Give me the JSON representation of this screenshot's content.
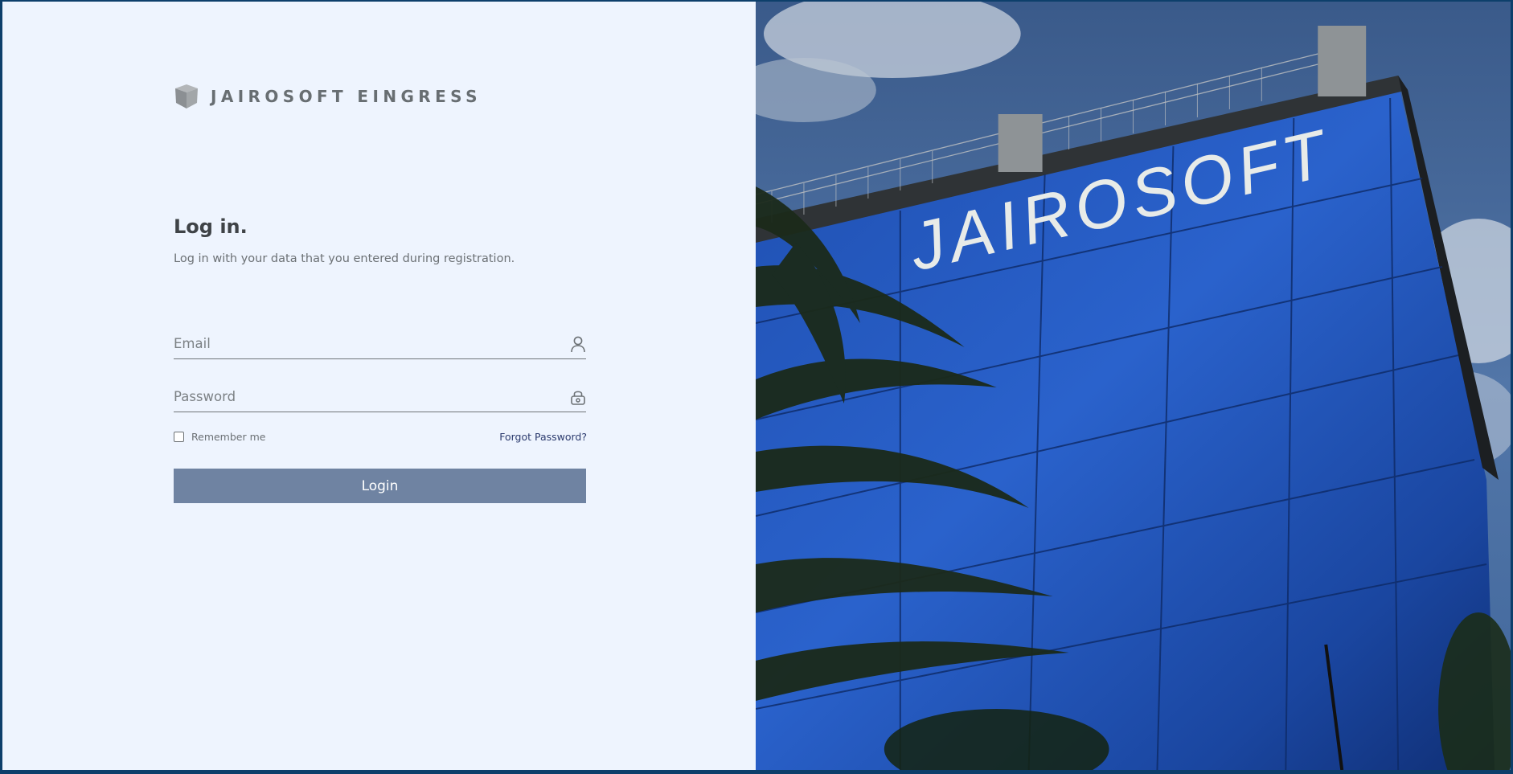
{
  "brand": {
    "name": "JAIROSOFT EINGRESS",
    "logo_icon": "cube-icon"
  },
  "login": {
    "title": "Log in.",
    "subtitle": "Log in with your data that you entered during registration.",
    "email_placeholder": "Email",
    "email_icon": "user-icon",
    "password_placeholder": "Password",
    "password_icon": "lock-icon",
    "remember_label": "Remember me",
    "remember_checked": false,
    "forgot_label": "Forgot Password?",
    "button_label": "Login"
  },
  "hero": {
    "building_sign": "JAIROSOFT"
  },
  "colors": {
    "panel_bg": "#eef4fe",
    "button_bg": "#6f83a2",
    "link": "#2c3b6e",
    "frame": "#0d3f6b"
  }
}
